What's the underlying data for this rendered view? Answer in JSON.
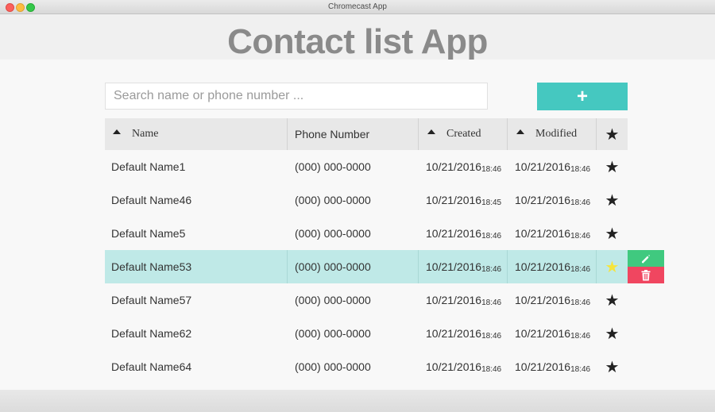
{
  "window": {
    "title": "Chromecast App"
  },
  "app": {
    "title": "Contact list App"
  },
  "search": {
    "placeholder": "Search name or phone number ..."
  },
  "add_button": {
    "label": "+"
  },
  "table": {
    "headers": {
      "name": "Name",
      "phone": "Phone Number",
      "created": "Created",
      "modified": "Modified",
      "star": "★"
    },
    "rows": [
      {
        "name": "Default Name1",
        "phone": "(000) 000-0000",
        "created_date": "10/21/2016",
        "created_time": "18:46",
        "modified_date": "10/21/2016",
        "modified_time": "18:46",
        "star": "★"
      },
      {
        "name": "Default Name46",
        "phone": "(000) 000-0000",
        "created_date": "10/21/2016",
        "created_time": "18:45",
        "modified_date": "10/21/2016",
        "modified_time": "18:46",
        "star": "★"
      },
      {
        "name": "Default Name5",
        "phone": "(000) 000-0000",
        "created_date": "10/21/2016",
        "created_time": "18:46",
        "modified_date": "10/21/2016",
        "modified_time": "18:46",
        "star": "★"
      },
      {
        "name": "Default Name53",
        "phone": "(000) 000-0000",
        "created_date": "10/21/2016",
        "created_time": "18:46",
        "modified_date": "10/21/2016",
        "modified_time": "18:46",
        "star": "★"
      },
      {
        "name": "Default Name57",
        "phone": "(000) 000-0000",
        "created_date": "10/21/2016",
        "created_time": "18:46",
        "modified_date": "10/21/2016",
        "modified_time": "18:46",
        "star": "★"
      },
      {
        "name": "Default Name62",
        "phone": "(000) 000-0000",
        "created_date": "10/21/2016",
        "created_time": "18:46",
        "modified_date": "10/21/2016",
        "modified_time": "18:46",
        "star": "★"
      },
      {
        "name": "Default Name64",
        "phone": "(000) 000-0000",
        "created_date": "10/21/2016",
        "created_time": "18:46",
        "modified_date": "10/21/2016",
        "modified_time": "18:46",
        "star": "★"
      }
    ]
  },
  "selected_row": {
    "edit_icon": "pencil-icon",
    "delete_icon": "trash-icon"
  },
  "colors": {
    "accent": "#45c8c0",
    "selected_row": "#bfe9e7",
    "edit": "#40c97f",
    "delete": "#f04660",
    "favorite_star": "#f5e53d"
  }
}
